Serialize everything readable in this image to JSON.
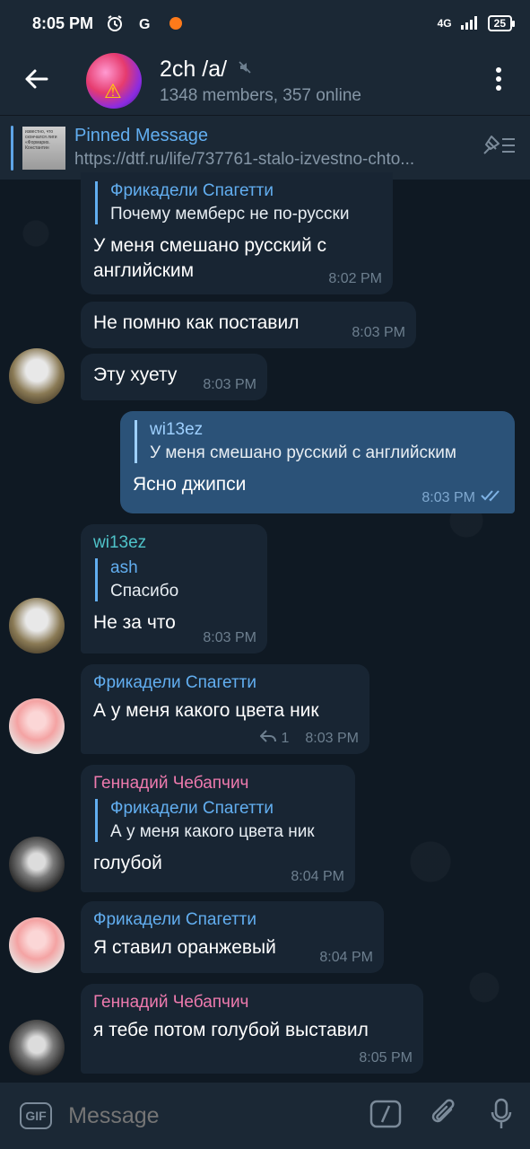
{
  "status_bar": {
    "time": "8:05 PM",
    "network": "4G",
    "battery": "25"
  },
  "header": {
    "title": "2ch /a/",
    "subtitle": "1348 members, 357 online"
  },
  "pinned": {
    "title": "Pinned Message",
    "link": "https://dtf.ru/life/737761-stalo-izvestno-chto...",
    "thumb_text": "известно, что скончался лиги «Формариs. Константин"
  },
  "messages": [
    {
      "reply_name": "Фрикадели Спагетти",
      "reply_text": "Почему мемберс не по-русски",
      "text": "У меня смешано русский с английским",
      "time": "8:02 PM"
    },
    {
      "text": "Не помню как поставил",
      "time": "8:03 PM"
    },
    {
      "text": "Эту хуету",
      "time": "8:03 PM"
    },
    {
      "reply_name": "wi13ez",
      "reply_text": "У меня смешано русский с английским",
      "text": "Ясно джипси",
      "time": "8:03 PM"
    },
    {
      "sender": "wi13ez",
      "reply_name": "ash",
      "reply_text": "Спасибо",
      "text": "Не за что",
      "time": "8:03 PM"
    },
    {
      "sender": "Фрикадели Спагетти",
      "text": "А у меня какого цвета ник",
      "replies": "1",
      "time": "8:03 PM"
    },
    {
      "sender": "Геннадий Чебапчич",
      "reply_name": "Фрикадели Спагетти",
      "reply_text": "А у меня какого цвета ник",
      "text": "голубой",
      "time": "8:04 PM"
    },
    {
      "sender": "Фрикадели Спагетти",
      "text": "Я ставил оранжевый",
      "time": "8:04 PM"
    },
    {
      "sender": "Геннадий Чебапчич",
      "text": "я тебе потом голубой выставил",
      "time": "8:05 PM"
    }
  ],
  "input": {
    "placeholder": "Message",
    "gif_label": "GIF"
  },
  "colors": {
    "background": "#0e1621",
    "bar": "#1b2835",
    "bubble_in": "#182533",
    "bubble_out": "#2b5278",
    "accent_blue": "#62aef0",
    "name_pink": "#ee7aae",
    "name_teal": "#4fc3c9"
  },
  "icons": [
    "back-arrow-icon",
    "mute-icon",
    "more-vert-icon",
    "unpin-list-icon",
    "double-check-icon",
    "reply-icon",
    "gif-icon",
    "command-slash-icon",
    "attach-icon",
    "mic-icon"
  ]
}
